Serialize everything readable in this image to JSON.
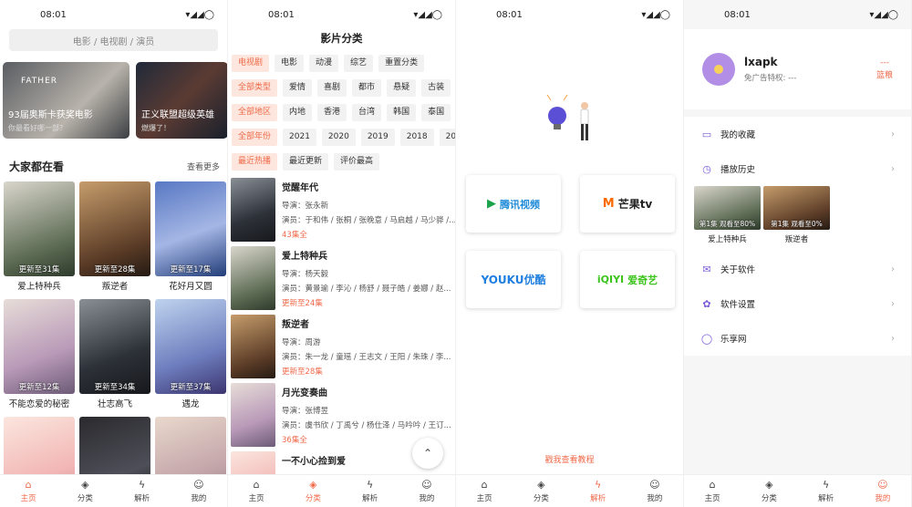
{
  "status": {
    "time": "08:01",
    "icons": "▾◢◢◯"
  },
  "tabs": [
    {
      "label": "主页",
      "icon": "⌂"
    },
    {
      "label": "分类",
      "icon": "◈"
    },
    {
      "label": "解析",
      "icon": "ϟ"
    },
    {
      "label": "我的",
      "icon": "☺"
    }
  ],
  "home": {
    "search_placeholder": "电影 / 电视剧 / 演员",
    "banners": [
      {
        "title": "93届奥斯卡获奖电影",
        "subtitle": "你最看好哪一部？",
        "tag": "FATHER"
      },
      {
        "title": "正义联盟超级英雄",
        "subtitle": "燃爆了！"
      }
    ],
    "section_title": "大家都在看",
    "more_label": "查看更多",
    "posters": [
      {
        "caption": "更新至31集",
        "title": "爱上特种兵"
      },
      {
        "caption": "更新至28集",
        "title": "叛逆者"
      },
      {
        "caption": "更新至17集",
        "title": "花好月又圆"
      },
      {
        "caption": "更新至12集",
        "title": "不能恋爱的秘密"
      },
      {
        "caption": "更新至34集",
        "title": "壮志高飞"
      },
      {
        "caption": "更新至37集",
        "title": "遇龙"
      },
      {
        "caption": "",
        "title": ""
      },
      {
        "caption": "",
        "title": ""
      },
      {
        "caption": "",
        "title": ""
      }
    ]
  },
  "category": {
    "title": "影片分类",
    "rows": [
      [
        {
          "label": "电视剧",
          "selected": true
        },
        {
          "label": "电影"
        },
        {
          "label": "动漫"
        },
        {
          "label": "综艺"
        },
        {
          "label": "重置分类"
        }
      ],
      [
        {
          "label": "全部类型",
          "selected": true
        },
        {
          "label": "爱情"
        },
        {
          "label": "喜剧"
        },
        {
          "label": "都市"
        },
        {
          "label": "悬疑"
        },
        {
          "label": "古装"
        }
      ],
      [
        {
          "label": "全部地区",
          "selected": true
        },
        {
          "label": "内地"
        },
        {
          "label": "香港"
        },
        {
          "label": "台湾"
        },
        {
          "label": "韩国"
        },
        {
          "label": "泰国"
        }
      ],
      [
        {
          "label": "全部年份",
          "selected": true
        },
        {
          "label": "2021"
        },
        {
          "label": "2020"
        },
        {
          "label": "2019"
        },
        {
          "label": "2018"
        },
        {
          "label": "201"
        }
      ],
      [
        {
          "label": "最近热播",
          "selected": true
        },
        {
          "label": "最近更新"
        },
        {
          "label": "评价最高"
        }
      ]
    ],
    "movies": [
      {
        "title": "觉醒年代",
        "director": "导演：张永新",
        "cast": "演员：于和伟 / 张桐 / 张晚意 / 马启越 / 马少骅 /...",
        "episodes": "43集全"
      },
      {
        "title": "爱上特种兵",
        "director": "导演：杨天毅",
        "cast": "演员：黄景瑜 / 李沁 / 杨舒 / 聂子皓 / 姜娜 / 赵...",
        "episodes": "更新至24集"
      },
      {
        "title": "叛逆者",
        "director": "导演：周游",
        "cast": "演员：朱一龙 / 童瑶 / 王志文 / 王阳 / 朱珠 / 李...",
        "episodes": "更新至28集"
      },
      {
        "title": "月光变奏曲",
        "director": "导演：张博昱",
        "cast": "演员：虞书欣 / 丁禹兮 / 杨仕泽 / 马吟吟 / 王订...",
        "episodes": "36集全"
      },
      {
        "title": "一不小心捡到爱",
        "director": "",
        "cast": "",
        "episodes": ""
      }
    ],
    "scroll_top_icon": "⌃"
  },
  "parse": {
    "platforms": [
      {
        "name": "腾讯视频",
        "color": "#1aa34a",
        "logo": "▶"
      },
      {
        "name": "芒果tv",
        "color": "#ff6a00",
        "logo": "M"
      },
      {
        "name": "YOUKU优酷",
        "color": "#1f7fe0",
        "logo": ""
      },
      {
        "name": "爱奇艺",
        "color": "#3cc41d",
        "logo": "iQIYI"
      }
    ],
    "tutorial_link": "戳我查看教程"
  },
  "mine": {
    "username": "lxapk",
    "vip_text": "免广告特权: ---",
    "renew_top": "---",
    "renew_label": "篮粮",
    "menu": [
      {
        "label": "我的收藏",
        "icon": "▭"
      },
      {
        "label": "播放历史",
        "icon": "◷"
      },
      {
        "label": "关于软件",
        "icon": "✉"
      },
      {
        "label": "软件设置",
        "icon": "✿"
      },
      {
        "label": "乐享网",
        "icon": "◯"
      }
    ],
    "history": [
      {
        "caption": "第1集 观看至80%",
        "title": "爱上特种兵"
      },
      {
        "caption": "第1集 观看至0%",
        "title": "叛逆者"
      }
    ]
  }
}
